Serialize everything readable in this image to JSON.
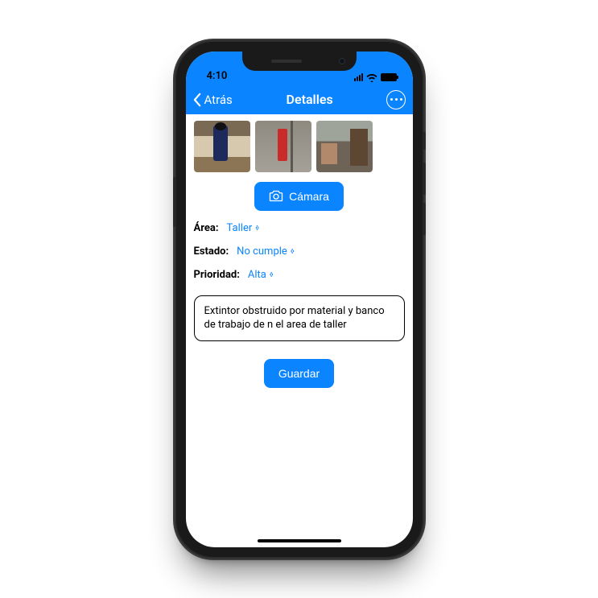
{
  "statusbar": {
    "time": "4:10"
  },
  "nav": {
    "back": "Atrás",
    "title": "Detalles"
  },
  "buttons": {
    "camera": "Cámara",
    "save": "Guardar"
  },
  "fields": {
    "area": {
      "label": "Área:",
      "value": "Taller"
    },
    "estado": {
      "label": "Estado:",
      "value": "No cumple"
    },
    "prioridad": {
      "label": "Prioridad:",
      "value": "Alta"
    }
  },
  "notes": "Extintor obstruido por material y banco de trabajo de n el area de taller"
}
